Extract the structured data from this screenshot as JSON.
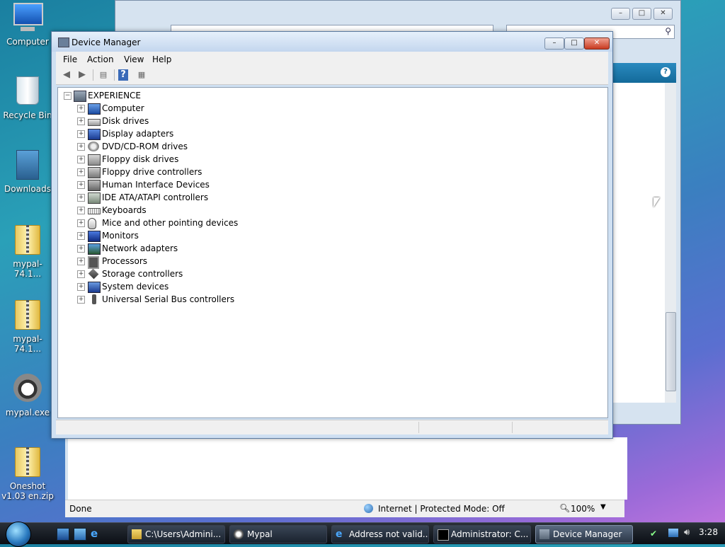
{
  "desktop": {
    "icons": [
      {
        "label": "Computer"
      },
      {
        "label": "Recycle Bin"
      },
      {
        "label": "Downloads"
      },
      {
        "label": "mypal-74.1..."
      },
      {
        "label": "mypal-74.1..."
      },
      {
        "label": "mypal.exe"
      },
      {
        "label": "Oneshot v1.03 en.zip"
      }
    ]
  },
  "ie_window": {
    "status_left": "Done",
    "zone": "Internet | Protected Mode: Off",
    "zoom": "100%"
  },
  "device_manager": {
    "title": "Device Manager",
    "menu": [
      "File",
      "Action",
      "View",
      "Help"
    ],
    "root": "EXPERIENCE",
    "devices": [
      {
        "label": "Computer",
        "icon": "computer-icon"
      },
      {
        "label": "Disk drives",
        "icon": "disk-drive-icon"
      },
      {
        "label": "Display adapters",
        "icon": "display-adapter-icon"
      },
      {
        "label": "DVD/CD-ROM drives",
        "icon": "dvd-drive-icon"
      },
      {
        "label": "Floppy disk drives",
        "icon": "floppy-drive-icon"
      },
      {
        "label": "Floppy drive controllers",
        "icon": "floppy-controller-icon"
      },
      {
        "label": "Human Interface Devices",
        "icon": "hid-icon"
      },
      {
        "label": "IDE ATA/ATAPI controllers",
        "icon": "ide-controller-icon"
      },
      {
        "label": "Keyboards",
        "icon": "keyboard-icon"
      },
      {
        "label": "Mice and other pointing devices",
        "icon": "mouse-icon"
      },
      {
        "label": "Monitors",
        "icon": "monitor-icon"
      },
      {
        "label": "Network adapters",
        "icon": "network-adapter-icon"
      },
      {
        "label": "Processors",
        "icon": "processor-icon"
      },
      {
        "label": "Storage controllers",
        "icon": "storage-controller-icon"
      },
      {
        "label": "System devices",
        "icon": "system-devices-icon"
      },
      {
        "label": "Universal Serial Bus controllers",
        "icon": "usb-icon"
      }
    ]
  },
  "taskbar": {
    "buttons": [
      {
        "label": "C:\\Users\\Admini...",
        "icon": "folder-icon"
      },
      {
        "label": "Mypal",
        "icon": "mypal-icon"
      },
      {
        "label": "Address not valid...",
        "icon": "ie-icon"
      },
      {
        "label": "Administrator: C...",
        "icon": "cmd-icon"
      },
      {
        "label": "Device Manager",
        "icon": "device-manager-icon"
      }
    ],
    "clock": "3:28"
  }
}
